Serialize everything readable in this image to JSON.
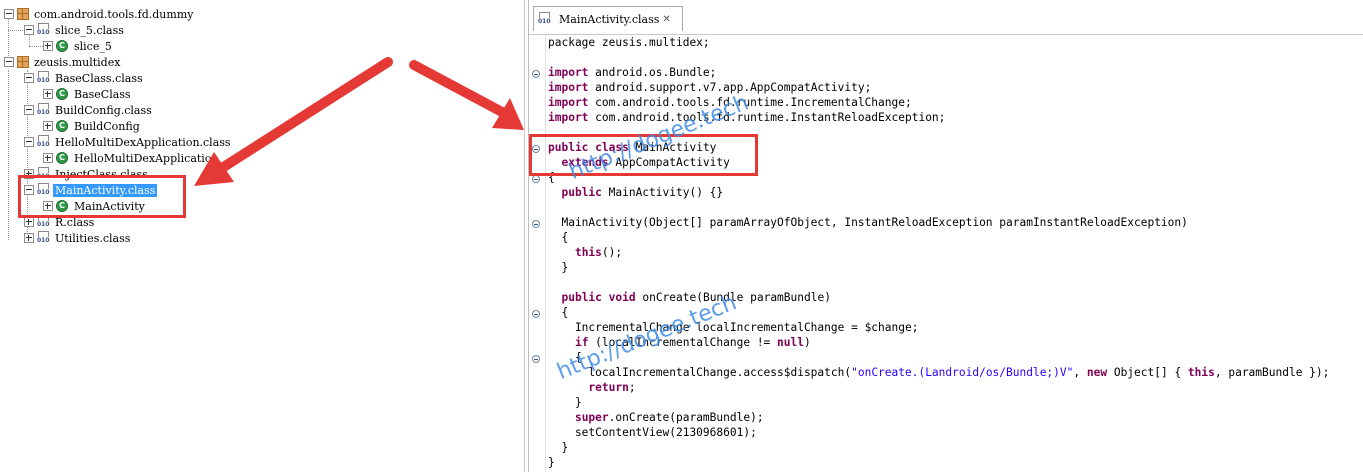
{
  "tree": {
    "items": [
      {
        "label": "com.android.tools.fd.dummy"
      },
      {
        "label": "slice_5.class"
      },
      {
        "label": "slice_5"
      },
      {
        "label": "zeusis.multidex"
      },
      {
        "label": "BaseClass.class"
      },
      {
        "label": "BaseClass"
      },
      {
        "label": "BuildConfig.class"
      },
      {
        "label": "BuildConfig"
      },
      {
        "label": "HelloMultiDexApplication.class"
      },
      {
        "label": "HelloMultiDexApplication"
      },
      {
        "label": "InjectClass.class"
      },
      {
        "label": "MainActivity.class"
      },
      {
        "label": "MainActivity"
      },
      {
        "label": "R.class"
      },
      {
        "label": "Utilities.class"
      }
    ],
    "selected": "MainActivity.class"
  },
  "editor": {
    "tab_label": "MainActivity.class",
    "tab_close": "✕",
    "code": [
      [
        {
          "t": "package zeusis.multidex;"
        }
      ],
      [],
      [
        {
          "t": "import",
          "k": 1
        },
        {
          "t": " android.os.Bundle;"
        }
      ],
      [
        {
          "t": "import",
          "k": 1
        },
        {
          "t": " android.support.v7.app.AppCompatActivity;"
        }
      ],
      [
        {
          "t": "import",
          "k": 1
        },
        {
          "t": " com.android.tools.fd.runtime.IncrementalChange;"
        }
      ],
      [
        {
          "t": "import",
          "k": 1
        },
        {
          "t": " com.android.tools.fd.runtime.InstantReloadException;"
        }
      ],
      [],
      [
        {
          "t": "public",
          "k": 1
        },
        {
          "t": " "
        },
        {
          "t": "class",
          "k": 1
        },
        {
          "t": " MainActivity"
        }
      ],
      [
        {
          "t": "  "
        },
        {
          "t": "extends",
          "k": 1
        },
        {
          "t": " AppCompatActivity"
        }
      ],
      [
        {
          "t": "{"
        }
      ],
      [
        {
          "t": "  "
        },
        {
          "t": "public",
          "k": 1
        },
        {
          "t": " MainActivity() {}"
        }
      ],
      [],
      [
        {
          "t": "  MainActivity(Object[] paramArrayOfObject, InstantReloadException paramInstantReloadException)"
        }
      ],
      [
        {
          "t": "  {"
        }
      ],
      [
        {
          "t": "    "
        },
        {
          "t": "this",
          "k": 1
        },
        {
          "t": "();"
        }
      ],
      [
        {
          "t": "  }"
        }
      ],
      [],
      [
        {
          "t": "  "
        },
        {
          "t": "public",
          "k": 1
        },
        {
          "t": " "
        },
        {
          "t": "void",
          "k": 1
        },
        {
          "t": " onCreate(Bundle paramBundle)"
        }
      ],
      [
        {
          "t": "  {"
        }
      ],
      [
        {
          "t": "    IncrementalChange localIncrementalChange = $change;"
        }
      ],
      [
        {
          "t": "    "
        },
        {
          "t": "if",
          "k": 1
        },
        {
          "t": " (localIncrementalChange != "
        },
        {
          "t": "null",
          "k": 1
        },
        {
          "t": ")"
        }
      ],
      [
        {
          "t": "    {"
        }
      ],
      [
        {
          "t": "      localIncrementalChange.access$dispatch("
        },
        {
          "t": "\"onCreate.(Landroid/os/Bundle;)V\"",
          "s": 1
        },
        {
          "t": ", "
        },
        {
          "t": "new",
          "k": 1
        },
        {
          "t": " Object[] { "
        },
        {
          "t": "this",
          "k": 1
        },
        {
          "t": ", paramBundle });"
        }
      ],
      [
        {
          "t": "      "
        },
        {
          "t": "return",
          "k": 1
        },
        {
          "t": ";"
        }
      ],
      [
        {
          "t": "    }"
        }
      ],
      [
        {
          "t": "    "
        },
        {
          "t": "super",
          "k": 1
        },
        {
          "t": ".onCreate(paramBundle);"
        }
      ],
      [
        {
          "t": "    setContentView(2130968601);"
        }
      ],
      [
        {
          "t": "  }"
        }
      ],
      [
        {
          "t": "}"
        }
      ]
    ]
  },
  "watermarks": [
    "http://dogee.tech",
    "http://dogee.tech"
  ],
  "colors": {
    "annotation_red": "#e53935",
    "keyword": "#7f0055",
    "string": "#2a00ff",
    "selection": "#3399ff",
    "watermark": "#408ce6"
  }
}
